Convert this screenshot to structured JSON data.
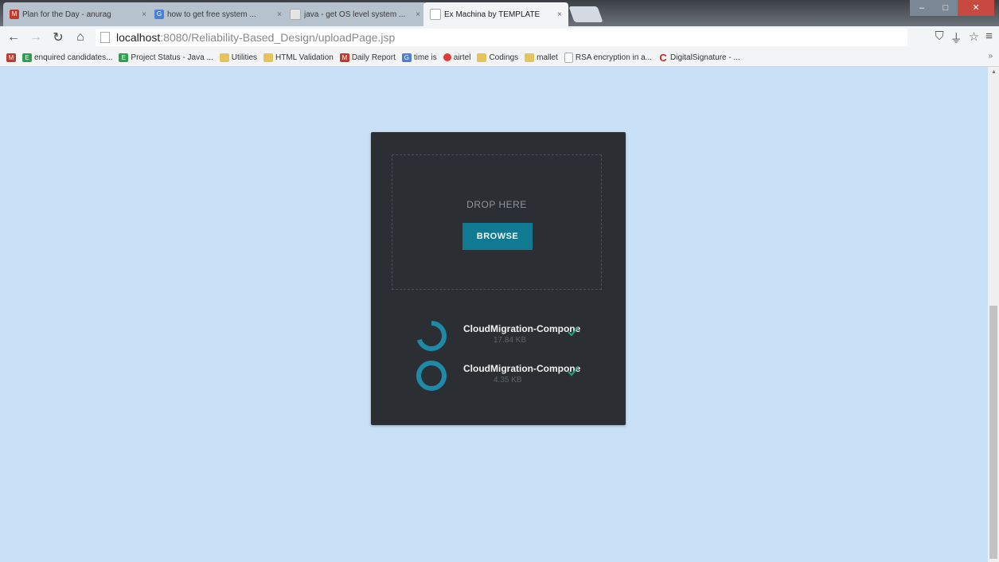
{
  "browser": {
    "tabs": [
      {
        "title": "Plan for the Day - anurag",
        "favicon_color": "#c0392b",
        "favicon_glyph": "M"
      },
      {
        "title": "how to get free system ...",
        "favicon_color": "#4a7fd4",
        "favicon_glyph": "G"
      },
      {
        "title": "java - get OS level system ...",
        "favicon_color": "#e5e5e5",
        "favicon_glyph": ""
      },
      {
        "title": "Ex Machina by TEMPLATE",
        "favicon_color": "#e5e5e5",
        "favicon_glyph": ""
      }
    ],
    "url": {
      "host": "localhost",
      "path": ":8080/Reliability-Based_Design/uploadPage.jsp"
    },
    "bookmarks": [
      {
        "label": "",
        "icon_color": "#c0392b",
        "icon_glyph": "M"
      },
      {
        "label": "enquired candidates...",
        "icon_color": "#2e9e4f",
        "icon_glyph": "E"
      },
      {
        "label": "Project Status - Java ...",
        "icon_color": "#2e9e4f",
        "icon_glyph": "E"
      },
      {
        "label": "Utilities",
        "icon_color": "#e6c35b",
        "icon_glyph": ""
      },
      {
        "label": "HTML Validation",
        "icon_color": "#e6c35b",
        "icon_glyph": ""
      },
      {
        "label": "Daily Report",
        "icon_color": "#c0392b",
        "icon_glyph": "M"
      },
      {
        "label": "time is",
        "icon_color": "#4a7fd4",
        "icon_glyph": "G"
      },
      {
        "label": "airtel",
        "icon_color": "#e53935",
        "icon_glyph": ""
      },
      {
        "label": "Codings",
        "icon_color": "#e6c35b",
        "icon_glyph": ""
      },
      {
        "label": "mallet",
        "icon_color": "#e6c35b",
        "icon_glyph": ""
      },
      {
        "label": "RSA encryption in a...",
        "icon_color": "#dddddd",
        "icon_glyph": ""
      },
      {
        "label": "DigitalSignature - ...",
        "icon_color": "#c62828",
        "icon_glyph": "C"
      }
    ]
  },
  "upload": {
    "drop_label": "DROP HERE",
    "browse_label": "BROWSE",
    "files": [
      {
        "name": "CloudMigration-Compone",
        "size": "17.84 KB",
        "progress": 0.7
      },
      {
        "name": "CloudMigration-Compone",
        "size": "4.35 KB",
        "progress": 1.0
      }
    ]
  },
  "colors": {
    "page_bg": "#c9e1f6",
    "card_bg": "#2b2f33",
    "accent": "#0f7a92",
    "ring": "#1f8aa8",
    "check": "#29a37f"
  }
}
